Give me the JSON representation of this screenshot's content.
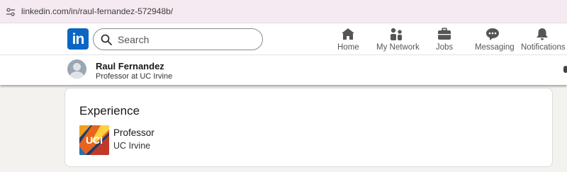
{
  "browser": {
    "url": "linkedin.com/in/raul-fernandez-572948b/",
    "site_info_icon": "tune-icon"
  },
  "nav": {
    "logo_text": "in",
    "search_placeholder": "Search",
    "items": [
      {
        "label": "Home",
        "icon": "home-icon"
      },
      {
        "label": "My Network",
        "icon": "network-icon"
      },
      {
        "label": "Jobs",
        "icon": "briefcase-icon"
      },
      {
        "label": "Messaging",
        "icon": "messaging-icon"
      },
      {
        "label": "Notifications",
        "icon": "bell-icon"
      }
    ]
  },
  "profile": {
    "name": "Raul Fernandez",
    "headline": "Professor at UC Irvine"
  },
  "experience": {
    "heading": "Experience",
    "entries": [
      {
        "title": "Professor",
        "company": "UC Irvine",
        "logo_text": "UCI"
      }
    ]
  },
  "colors": {
    "brand": "#0a66c2",
    "page_bg": "#f4f2ee",
    "url_bar_bg": "#f5eaf1"
  }
}
